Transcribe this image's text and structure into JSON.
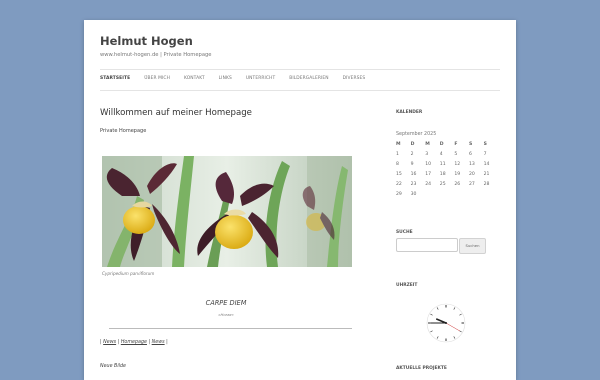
{
  "site": {
    "title": "Helmut Hogen",
    "description": "www.helmut-hogen.de | Private Homepage"
  },
  "nav": {
    "items": [
      {
        "label": "STARTSEITE",
        "active": true
      },
      {
        "label": "ÜBER MICH",
        "active": false
      },
      {
        "label": "KONTAKT",
        "active": false
      },
      {
        "label": "LINKS",
        "active": false
      },
      {
        "label": "UNTERRICHT",
        "active": false
      },
      {
        "label": "BILDERGALERIEN",
        "active": false
      },
      {
        "label": "DIVERSES",
        "active": false
      }
    ]
  },
  "main": {
    "title": "Willkommen auf meiner Homepage",
    "subtitle": "Private Homepage",
    "image_caption": "Cypripedium parviflorum",
    "quote": "CARPE DIEM",
    "quote_source": "»Horaz«",
    "links": {
      "sep": "|",
      "news": "News",
      "homepage": "Homepage"
    },
    "neue_bilder": "Neue Bilde"
  },
  "sidebar": {
    "kalender": {
      "title": "KALENDER",
      "caption": "September 2025",
      "weekdays": [
        "M",
        "D",
        "M",
        "D",
        "F",
        "S",
        "S"
      ],
      "rows": [
        [
          "1",
          "2",
          "3",
          "4",
          "5",
          "6",
          "7"
        ],
        [
          "8",
          "9",
          "10",
          "11",
          "12",
          "13",
          "14"
        ],
        [
          "15",
          "16",
          "17",
          "18",
          "19",
          "20",
          "21"
        ],
        [
          "22",
          "23",
          "24",
          "25",
          "26",
          "27",
          "28"
        ],
        [
          "29",
          "30",
          "",
          "",
          "",
          "",
          ""
        ]
      ]
    },
    "suche": {
      "title": "SUCHE",
      "input_value": "",
      "button_label": "Suchen"
    },
    "uhrzeit": {
      "title": "UHRZEIT",
      "hours": 9,
      "minutes": 45,
      "seconds": 20
    },
    "projekte": {
      "title": "AKTUELLE PROJEKTE"
    }
  },
  "colors": {
    "background": "#7f9bc0",
    "flower_petal": "#5b2a36",
    "flower_lip": "#e9c21c",
    "leaf": "#6fa55a"
  }
}
